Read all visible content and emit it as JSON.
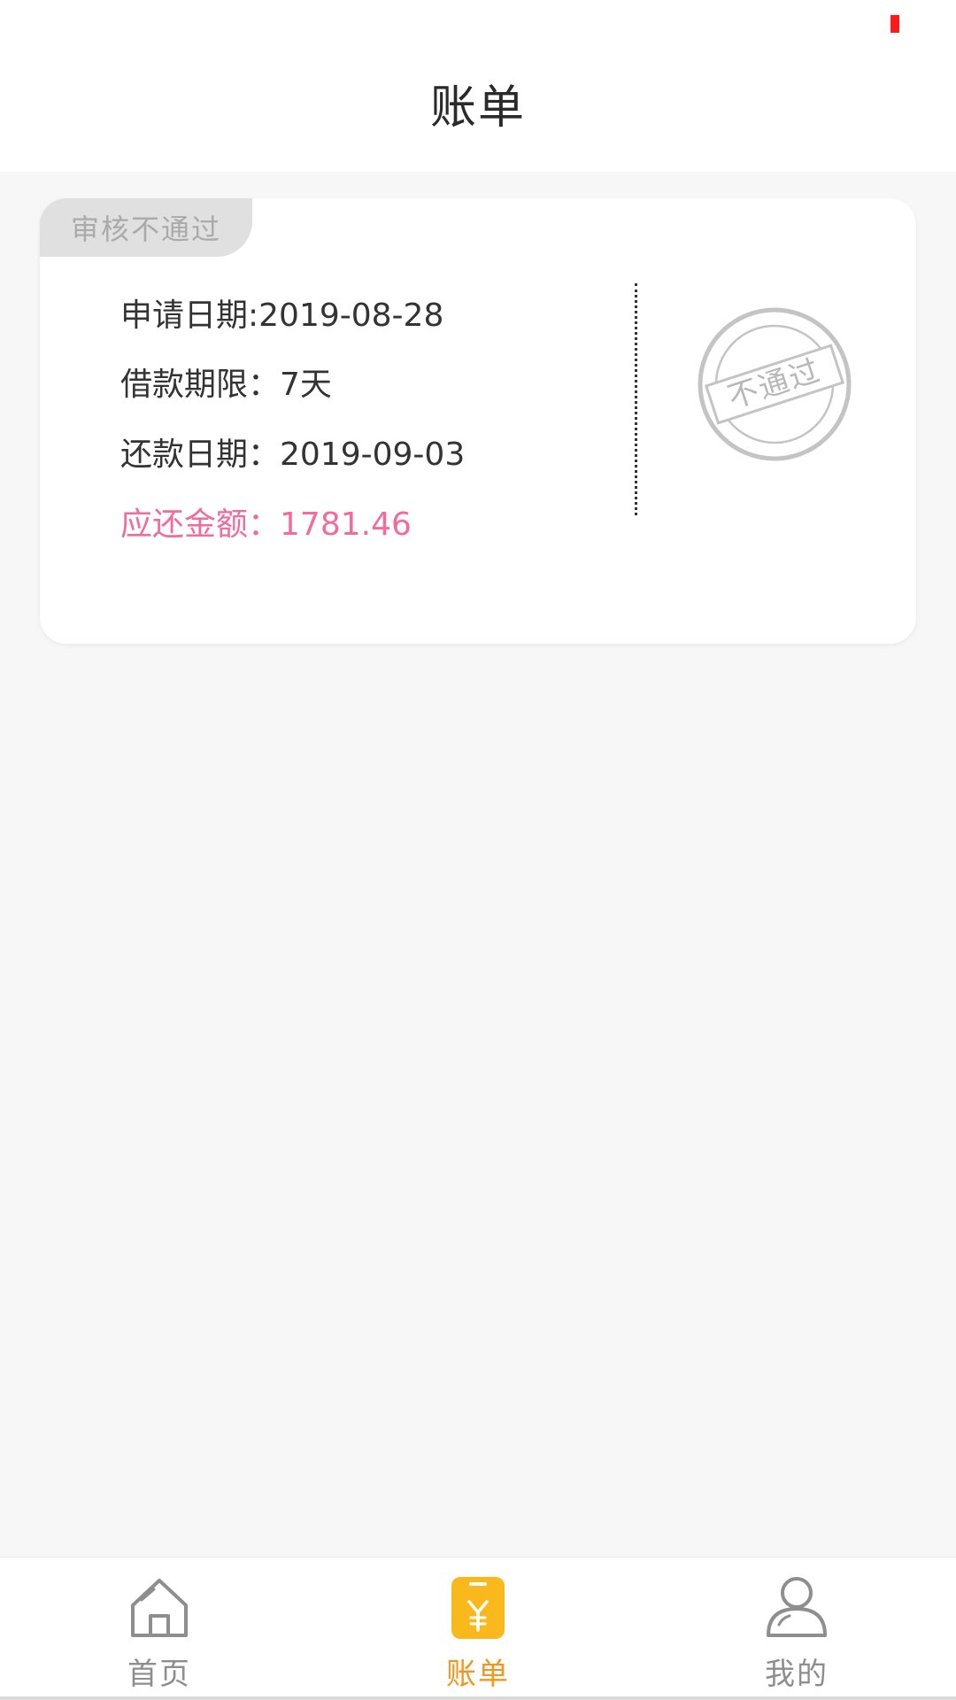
{
  "header": {
    "title": "账单"
  },
  "bill_card": {
    "status_tab": "审核不通过",
    "apply_date_label": "申请日期:",
    "apply_date_value": "2019-08-28",
    "term_label": "借款期限：",
    "term_value": "7天",
    "repay_date_label": "还款日期：",
    "repay_date_value": "2019-09-03",
    "amount_label": "应还金额：",
    "amount_value": "1781.46",
    "stamp_text": "不通过"
  },
  "tab_bar": {
    "items": [
      {
        "label": "首页",
        "icon": "home-icon",
        "active": false
      },
      {
        "label": "账单",
        "icon": "bill-icon",
        "active": true
      },
      {
        "label": "我的",
        "icon": "profile-icon",
        "active": false
      }
    ]
  },
  "colors": {
    "accent": "#f4961b",
    "amount": "#f36b9b",
    "status_indicator": "#ff1b1b"
  }
}
